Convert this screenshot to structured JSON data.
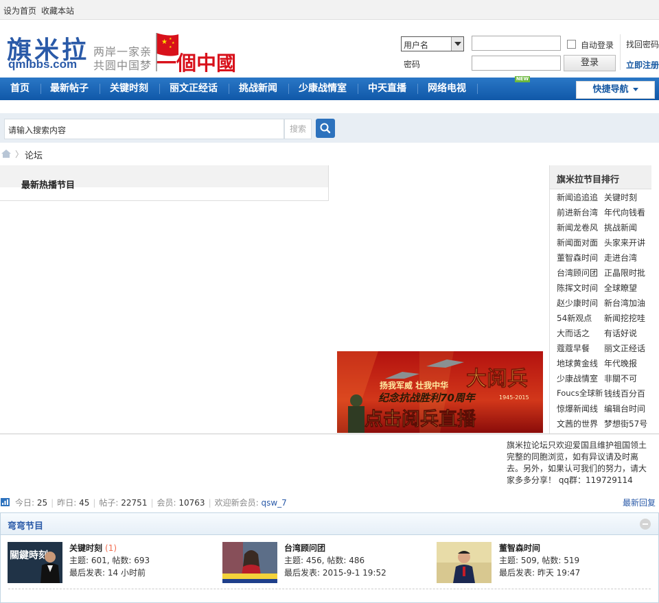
{
  "topbar": {
    "set_home": "设为首页",
    "bookmark": "收藏本站"
  },
  "logo": {
    "name": "旗米拉",
    "url": "qmlbbs.com",
    "slogan_line1": "两岸一家亲",
    "slogan_line2": "共圆中国梦",
    "banner_text": "一個中國"
  },
  "login": {
    "username_select": "用户名",
    "password_label": "密码",
    "auto_login_label": "自动登录",
    "login_button": "登录",
    "forgot_password": "找回密码",
    "register": "立即注册"
  },
  "nav": {
    "items": [
      "首页",
      "最新帖子",
      "关键时刻",
      "丽文正经话",
      "挑战新闻",
      "少康战情室",
      "中天直播",
      "网络电视"
    ],
    "new_badge": "NEW",
    "quick_nav": "快捷导航"
  },
  "search": {
    "placeholder": "请输入搜索内容",
    "small_button": "搜索"
  },
  "breadcrumb": {
    "current": "论坛"
  },
  "hot": {
    "title": "最新热播节目"
  },
  "ranking": {
    "title": "旗米拉节目排行",
    "items": [
      [
        "新闻追追追",
        "关键时刻"
      ],
      [
        "前进新台湾",
        "年代向钱看"
      ],
      [
        "新闻龙卷风",
        "挑战新闻"
      ],
      [
        "新闻面对面",
        "头家来开讲"
      ],
      [
        "董智森时间",
        "走进台湾"
      ],
      [
        "台湾顾问团",
        "正晶限时批"
      ],
      [
        "陈挥文时间",
        "全球瞭望"
      ],
      [
        "赵少康时间",
        "新台湾加油"
      ],
      [
        "54新观点",
        "新闻挖挖哇"
      ],
      [
        "大而话之",
        "有话好说"
      ],
      [
        "蔻蔻早餐",
        "丽文正经话"
      ],
      [
        "地球黄金线",
        "年代晚报"
      ],
      [
        "少康战情室",
        "非關不可"
      ],
      [
        "Foucs全球新",
        "钱线百分百"
      ],
      [
        "惊爆新闻线",
        "编辑台时间"
      ],
      [
        "文茜的世界",
        "梦想街57号"
      ]
    ]
  },
  "parade_banner": {
    "line1": "扬我军威 壮我中华",
    "line2": "纪念抗战胜利70周年",
    "title": "大阅兵",
    "years": "1945-2015",
    "bottom": "点击阅兵直播"
  },
  "notice": "旗米拉论坛只欢迎爱国且维护祖国领土完整的同胞浏览，如有异议请及时离去。另外，如果认可我们的努力，请大家多多分享！ qq群：119729114",
  "stats": {
    "today_label": "今日:",
    "today": "25",
    "yesterday_label": "昨日:",
    "yesterday": "45",
    "posts_label": "帖子:",
    "posts": "22751",
    "members_label": "会员:",
    "members": "10763",
    "welcome_label": "欢迎新会员:",
    "newest_member": "qsw_7",
    "latest_reply": "最新回复"
  },
  "forum_section": {
    "title": "弯弯节目",
    "forums": [
      {
        "name": "关键时刻",
        "today": "(1)",
        "stats": "主题: 601, 帖数: 693",
        "last_post": "最后发表: 14 小时前",
        "thumb_text": "關鍵時刻"
      },
      {
        "name": "台湾顾问团",
        "today": "",
        "stats": "主题: 456, 帖数: 486",
        "last_post": "最后发表: 2015-9-1 19:52",
        "thumb_text": ""
      },
      {
        "name": "董智森时间",
        "today": "",
        "stats": "主题: 509, 帖数: 519",
        "last_post": "最后发表: 昨天 19:47",
        "thumb_text": ""
      }
    ]
  },
  "colors": {
    "nav_blue": "#1a66b5",
    "brand_blue": "#2a5aa8",
    "accent_red": "#c8141c",
    "new_green": "#6cb83e"
  }
}
